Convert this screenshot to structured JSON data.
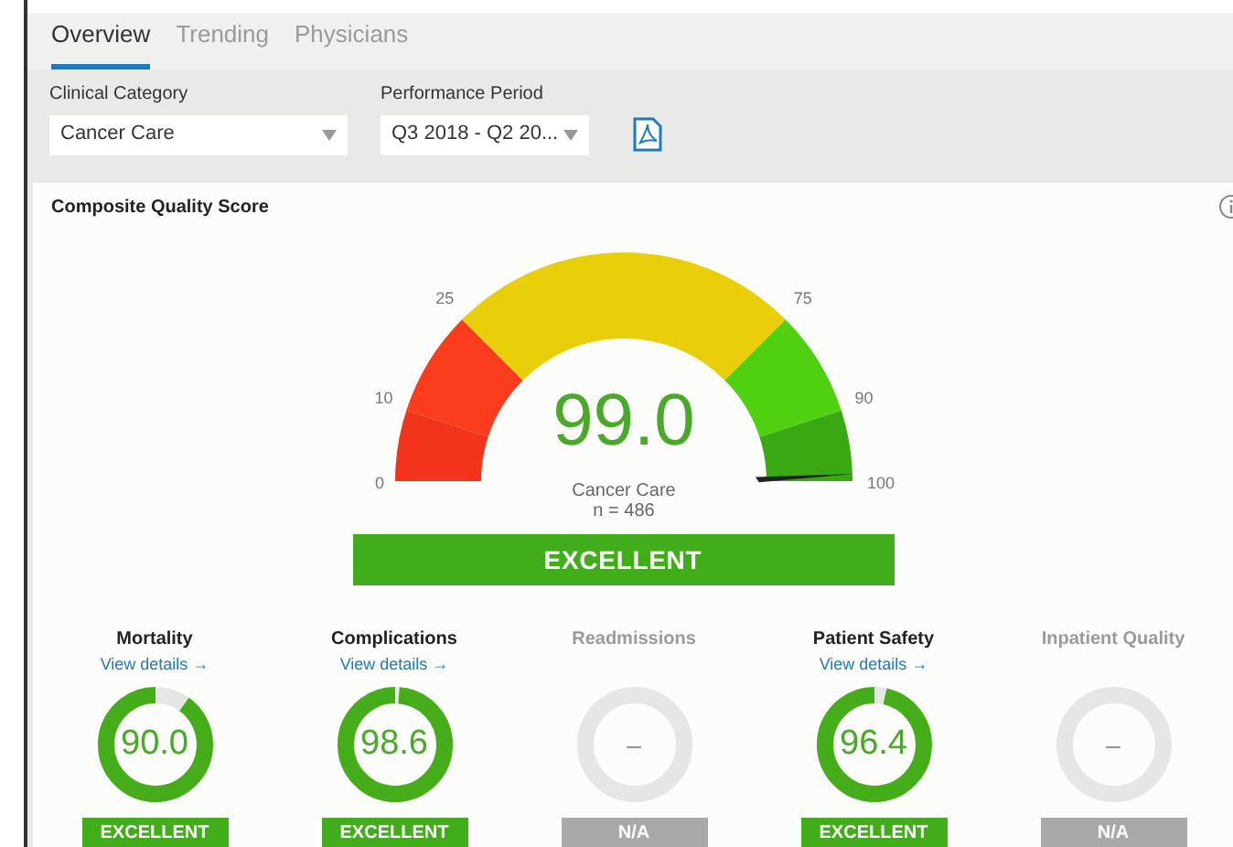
{
  "tabs": [
    {
      "label": "Overview",
      "selected": true
    },
    {
      "label": "Trending",
      "selected": false
    },
    {
      "label": "Physicians",
      "selected": false
    }
  ],
  "filters": [
    {
      "label": "Clinical Category",
      "value": "Cancer Care"
    },
    {
      "label": "Performance Period",
      "value": "Q3 2018 - Q2 20..."
    }
  ],
  "card": {
    "title": "Composite Quality Score",
    "gauge": {
      "score": "99.0",
      "category": "Cancer Care",
      "count": "n = 486",
      "ticks": [
        "0",
        "10",
        "25",
        "75",
        "90",
        "100"
      ],
      "rating": "EXCELLENT"
    },
    "metrics": [
      {
        "name": "Mortality",
        "link": "View details →",
        "disabled": false,
        "score": "90.0",
        "rating": "EXCELLENT"
      },
      {
        "name": "Complications",
        "link": "View details →",
        "disabled": false,
        "score": "98.6",
        "rating": "EXCELLENT"
      },
      {
        "name": "Readmissions",
        "disabled": true,
        "score": "–",
        "rating": "N/A"
      },
      {
        "name": "Patient Safety",
        "link": "View details →",
        "disabled": false,
        "score": "96.4",
        "rating": "EXCELLENT"
      },
      {
        "name": "Inpatient Quality",
        "disabled": true,
        "score": "–",
        "rating": "N/A"
      }
    ]
  }
}
